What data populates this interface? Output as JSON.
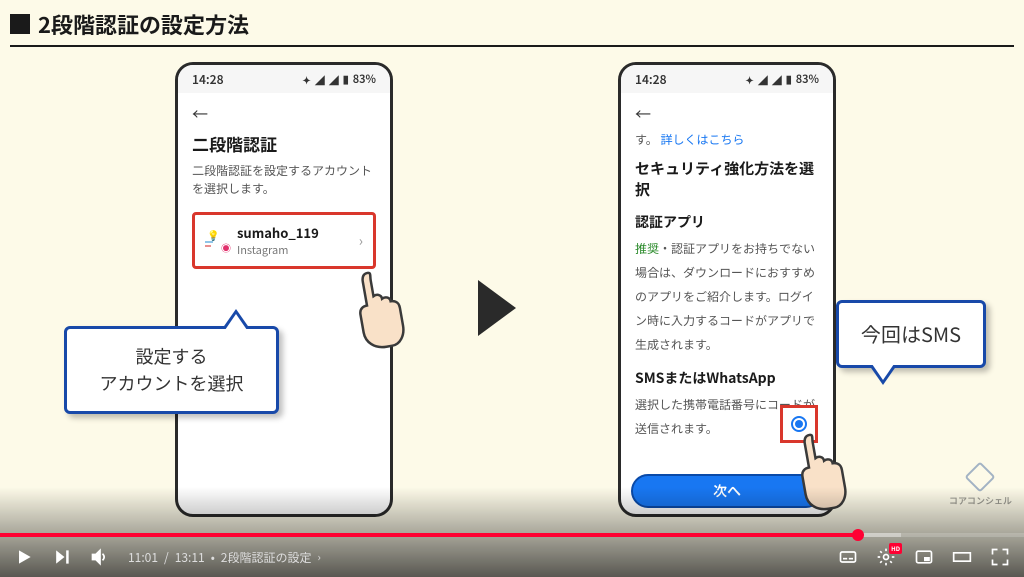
{
  "title": "2段階認証の設定方法",
  "phone_status": {
    "time": "14:28",
    "network_icon": "📶",
    "bt_icon": "✦",
    "battery_text": "83%",
    "battery_icon": "🔋"
  },
  "phone_left": {
    "heading": "二段階認証",
    "description": "二段階認証を設定するアカウントを選択します。",
    "account_name": "sumaho_119",
    "account_sub": "Instagram"
  },
  "phone_right": {
    "snippet_suffix": "す。",
    "link": "詳しくはこちら",
    "section_heading": "セキュリティ強化方法を選択",
    "opt1_title": "認証アプリ",
    "opt1_rec": "推奨",
    "opt1_desc": "・認証アプリをお持ちでない場合は、ダウンロードにおすすめのアプリをご紹介します。ログイン時に入力するコードがアプリで生成されます。",
    "opt2_title": "SMSまたはWhatsApp",
    "opt2_desc": "選択した携帯電話番号にコードが送信されます。",
    "next_button": "次へ"
  },
  "callouts": {
    "left_line1": "設定する",
    "left_line2": "アカウントを選択",
    "right": "今回はSMS"
  },
  "watermark": "コアコンシェル",
  "player": {
    "current_time": "11:01",
    "duration": "13:11",
    "chapter": "2段階認証の設定",
    "hd_label": "HD"
  }
}
